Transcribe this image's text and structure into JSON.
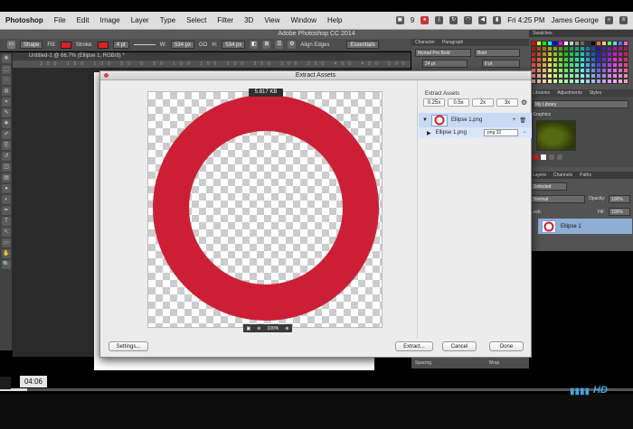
{
  "menubar": {
    "app": "Photoshop",
    "items": [
      "File",
      "Edit",
      "Image",
      "Layer",
      "Type",
      "Select",
      "Filter",
      "3D",
      "View",
      "Window",
      "Help"
    ],
    "badge": "9",
    "time": "Fri 4:25 PM",
    "user": "James George"
  },
  "window_title": "Adobe Photoshop CC 2014",
  "options_bar": {
    "shape_mode": "Shape",
    "fill_label": "Fill:",
    "stroke_label": "Stroke:",
    "stroke_width": "4 pt",
    "w_value": "534 px",
    "go_label": "GO",
    "h_value": "534 px",
    "align_edges": "Align Edges",
    "workspace": "Essentials"
  },
  "document_tab": "Untitled-1 @ 66.7% (Ellipse 1, RGB/8) *",
  "ruler_ticks": "200 150 100 50 0 50 100 150 200 250 300 350 400 450 500 550",
  "dialog": {
    "title": "Extract Assets",
    "file_size_badge": "5.817 KB",
    "zoom_label": "100%",
    "extract_assets_label": "Extract Assets",
    "scales": [
      "0.25x",
      "0.5x",
      "2x",
      "3x"
    ],
    "asset_name": "Ellipse 1.png",
    "sub_asset_name": "Ellipse 1.png",
    "format": "png 32",
    "buttons": {
      "settings": "Settings...",
      "extract": "Extract...",
      "cancel": "Cancel",
      "done": "Done"
    },
    "ring_color": "#cc1f35"
  },
  "character_panel": {
    "tabs": [
      "Character",
      "Paragraph"
    ],
    "font": "Myriad Pro Bold",
    "style": "Bold",
    "size": "24 pt",
    "leading": "8 pt"
  },
  "right_panels": {
    "swatches_tab": "Swatches",
    "lib_tabs": [
      "Libraries",
      "Adjustments",
      "Styles"
    ],
    "library_name": "My Library",
    "graphics_label": "Graphics",
    "layers_tabs": [
      "Layers",
      "Channels",
      "Paths"
    ],
    "filter_label": "Selected",
    "blend_mode": "Normal",
    "opacity_label": "Opacity:",
    "opacity_value": "100%",
    "lock_label": "Lock:",
    "fill_label": "Fill:",
    "fill_value": "100%",
    "layer_name": "Ellipse 1",
    "spacing_label": "Spacing",
    "wrap_label": "Wrap"
  },
  "video": {
    "timestamp": "04:06"
  },
  "tool_icons": [
    "move-icon",
    "marquee-icon",
    "lasso-icon",
    "quick-select-icon",
    "crop-icon",
    "eyedropper-icon",
    "healing-icon",
    "brush-icon",
    "stamp-icon",
    "history-brush-icon",
    "eraser-icon",
    "gradient-icon",
    "blur-icon",
    "dodge-icon",
    "pen-icon",
    "type-icon",
    "path-select-icon",
    "shape-icon",
    "hand-icon",
    "zoom-icon"
  ],
  "tool_glyphs": [
    "✥",
    "⬚",
    "◌",
    "◍",
    "⌗",
    "✎",
    "✚",
    "✐",
    "⎘",
    "↺",
    "◫",
    "▤",
    "●",
    "◐",
    "✒",
    "T",
    "↖",
    "▭",
    "✋",
    "🔍"
  ],
  "swatch_colors": [
    "#ff0000",
    "#ffff00",
    "#00ff00",
    "#00ffff",
    "#0000ff",
    "#ff00ff",
    "#ffffff",
    "#cccccc",
    "#999999",
    "#666666",
    "#333333",
    "#000000",
    "#ff6666",
    "#ffcc66",
    "#66ff66",
    "#66ccff",
    "#6666ff",
    "#ff66cc"
  ]
}
